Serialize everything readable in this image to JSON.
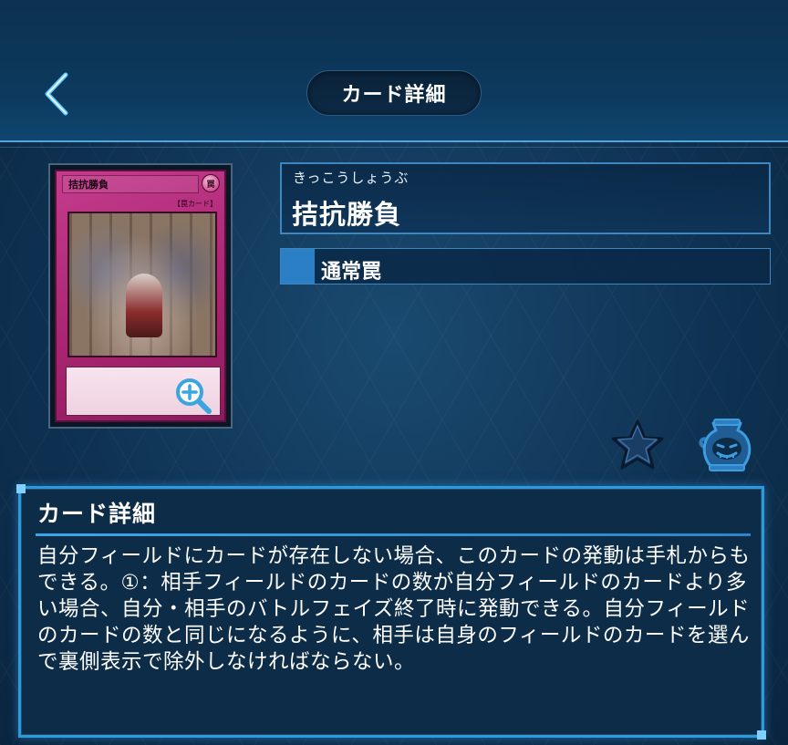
{
  "header": {
    "title": "カード詳細",
    "back_icon": "chevron-left-icon"
  },
  "card": {
    "image_name_text": "拮抗勝負",
    "image_attribute_text": "罠",
    "image_type_text": "【罠カード】",
    "frame_color": "#b62a80",
    "zoom_icon": "magnify-plus-icon"
  },
  "name_panel": {
    "ruby": "きっこうしょうぶ",
    "name": "拮抗勝負"
  },
  "type_panel": {
    "type": "通常罠",
    "swatch_color": "#2b7fc4"
  },
  "actions": {
    "favorite_icon": "star-icon",
    "pot_icon": "pot-of-greed-icon"
  },
  "detail": {
    "heading": "カード詳細",
    "text": "自分フィールドにカードが存在しない場合、このカードの発動は手札からもできる。①：相手フィールドのカードの数が自分フィールドのカードより多い場合、自分・相手のバトルフェイズ終了時に発動できる。自分フィールドのカードの数と同じになるように、相手は自身のフィールドのカードを選んで裏側表示で除外しなければならない。"
  },
  "colors": {
    "accent": "#2b9be0",
    "background": "#0f3354"
  }
}
